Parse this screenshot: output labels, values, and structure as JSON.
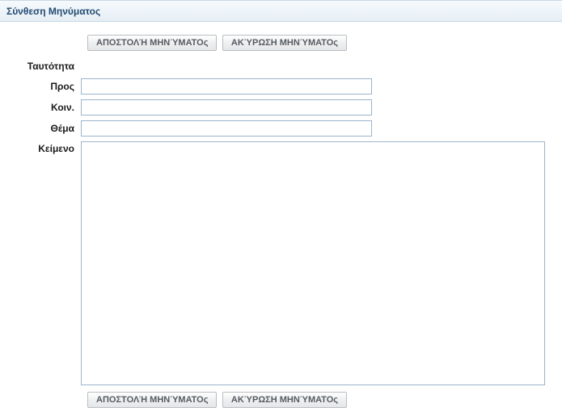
{
  "header": {
    "title": "Σύνθεση Μηνύματος"
  },
  "buttons": {
    "send": "ΑΠΟΣΤΟΛΉ ΜΗΝΎΜΑΤΟς",
    "cancel": "ΑΚΎΡΩΣΗ ΜΗΝΎΜΑΤΟς"
  },
  "fields": {
    "identity_label": "Ταυτότητα",
    "identity_value": "",
    "to_label": "Προς",
    "to_value": "",
    "cc_label": "Κοιν.",
    "cc_value": "",
    "subject_label": "Θέμα",
    "subject_value": "",
    "body_label": "Κείμενο",
    "body_value": ""
  }
}
